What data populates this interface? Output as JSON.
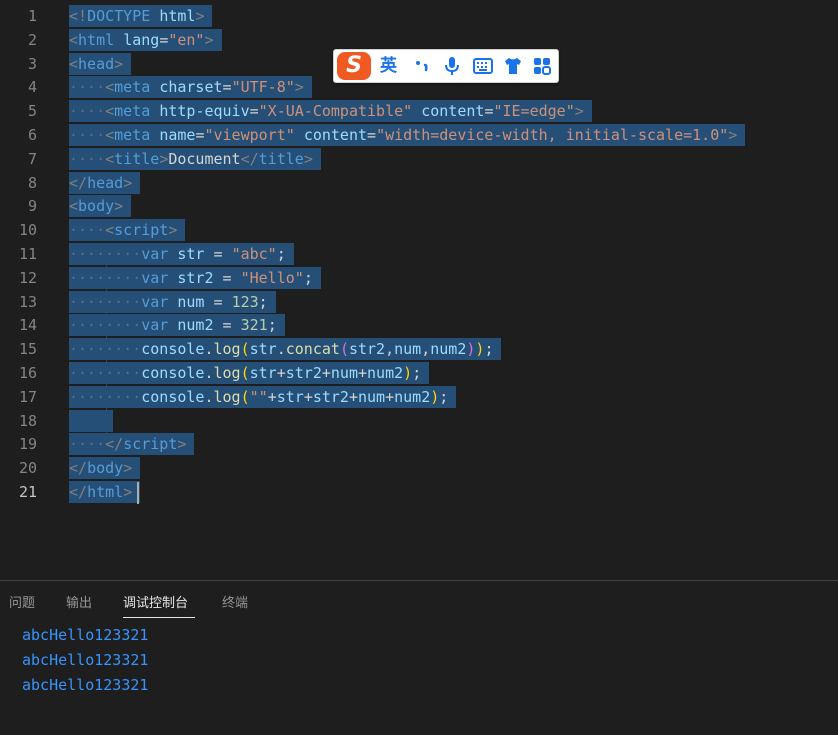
{
  "editor": {
    "lines": [
      {
        "num": "1",
        "segs": [
          [
            "tg",
            "<!"
          ],
          [
            "tn",
            "DOCTYPE"
          ],
          [
            "pl",
            " "
          ],
          [
            "an",
            "html"
          ],
          [
            "tg",
            ">"
          ]
        ]
      },
      {
        "num": "2",
        "segs": [
          [
            "tg",
            "<"
          ],
          [
            "tn",
            "html"
          ],
          [
            "pl",
            " "
          ],
          [
            "an",
            "lang"
          ],
          [
            "pl",
            "="
          ],
          [
            "av",
            "\"en\""
          ],
          [
            "tg",
            ">"
          ]
        ]
      },
      {
        "num": "3",
        "segs": [
          [
            "tg",
            "<"
          ],
          [
            "tn",
            "head"
          ],
          [
            "tg",
            ">"
          ]
        ]
      },
      {
        "num": "4",
        "segs": [
          [
            "ws",
            "····"
          ],
          [
            "tg",
            "<"
          ],
          [
            "tn",
            "meta"
          ],
          [
            "pl",
            " "
          ],
          [
            "an",
            "charset"
          ],
          [
            "pl",
            "="
          ],
          [
            "av",
            "\"UTF-8\""
          ],
          [
            "tg",
            ">"
          ]
        ]
      },
      {
        "num": "5",
        "segs": [
          [
            "ws",
            "····"
          ],
          [
            "tg",
            "<"
          ],
          [
            "tn",
            "meta"
          ],
          [
            "pl",
            " "
          ],
          [
            "an",
            "http-equiv"
          ],
          [
            "pl",
            "="
          ],
          [
            "av",
            "\"X-UA-Compatible\""
          ],
          [
            "pl",
            " "
          ],
          [
            "an",
            "content"
          ],
          [
            "pl",
            "="
          ],
          [
            "av",
            "\"IE=edge\""
          ],
          [
            "tg",
            ">"
          ]
        ]
      },
      {
        "num": "6",
        "segs": [
          [
            "ws",
            "····"
          ],
          [
            "tg",
            "<"
          ],
          [
            "tn",
            "meta"
          ],
          [
            "pl",
            " "
          ],
          [
            "an",
            "name"
          ],
          [
            "pl",
            "="
          ],
          [
            "av",
            "\"viewport\""
          ],
          [
            "pl",
            " "
          ],
          [
            "an",
            "content"
          ],
          [
            "pl",
            "="
          ],
          [
            "av",
            "\"width=device-width, initial-scale=1.0\""
          ],
          [
            "tg",
            ">"
          ]
        ]
      },
      {
        "num": "7",
        "segs": [
          [
            "ws",
            "····"
          ],
          [
            "tg",
            "<"
          ],
          [
            "tn",
            "title"
          ],
          [
            "tg",
            ">"
          ],
          [
            "pl",
            "Document"
          ],
          [
            "tg",
            "</"
          ],
          [
            "tn",
            "title"
          ],
          [
            "tg",
            ">"
          ]
        ]
      },
      {
        "num": "8",
        "segs": [
          [
            "tg",
            "</"
          ],
          [
            "tn",
            "head"
          ],
          [
            "tg",
            ">"
          ]
        ]
      },
      {
        "num": "9",
        "segs": [
          [
            "tg",
            "<"
          ],
          [
            "tn",
            "body"
          ],
          [
            "tg",
            ">"
          ]
        ]
      },
      {
        "num": "10",
        "segs": [
          [
            "ws",
            "····"
          ],
          [
            "tg",
            "<"
          ],
          [
            "tn",
            "script"
          ],
          [
            "tg",
            ">"
          ]
        ]
      },
      {
        "num": "11",
        "segs": [
          [
            "ws",
            "········"
          ],
          [
            "kw",
            "var"
          ],
          [
            "pl",
            " "
          ],
          [
            "vn",
            "str"
          ],
          [
            "pl",
            " = "
          ],
          [
            "st",
            "\"abc\""
          ],
          [
            "pl",
            ";"
          ]
        ]
      },
      {
        "num": "12",
        "segs": [
          [
            "ws",
            "········"
          ],
          [
            "kw",
            "var"
          ],
          [
            "pl",
            " "
          ],
          [
            "vn",
            "str2"
          ],
          [
            "pl",
            " = "
          ],
          [
            "st",
            "\"Hello\""
          ],
          [
            "pl",
            ";"
          ]
        ]
      },
      {
        "num": "13",
        "segs": [
          [
            "ws",
            "········"
          ],
          [
            "kw",
            "var"
          ],
          [
            "pl",
            " "
          ],
          [
            "vn",
            "num"
          ],
          [
            "pl",
            " = "
          ],
          [
            "nm",
            "123"
          ],
          [
            "pl",
            ";"
          ]
        ]
      },
      {
        "num": "14",
        "segs": [
          [
            "ws",
            "········"
          ],
          [
            "kw",
            "var"
          ],
          [
            "pl",
            " "
          ],
          [
            "vn",
            "num2"
          ],
          [
            "pl",
            " = "
          ],
          [
            "nm",
            "321"
          ],
          [
            "pl",
            ";"
          ]
        ]
      },
      {
        "num": "15",
        "segs": [
          [
            "ws",
            "········"
          ],
          [
            "vn",
            "console"
          ],
          [
            "pl",
            "."
          ],
          [
            "fn",
            "log"
          ],
          [
            "br2",
            "("
          ],
          [
            "vn",
            "str"
          ],
          [
            "pl",
            "."
          ],
          [
            "fn",
            "concat"
          ],
          [
            "br1",
            "("
          ],
          [
            "vn",
            "str2"
          ],
          [
            "pl",
            ","
          ],
          [
            "vn",
            "num"
          ],
          [
            "pl",
            ","
          ],
          [
            "vn",
            "num2"
          ],
          [
            "br1",
            ")"
          ],
          [
            "br2",
            ")"
          ],
          [
            "pl",
            ";"
          ]
        ]
      },
      {
        "num": "16",
        "segs": [
          [
            "ws",
            "········"
          ],
          [
            "vn",
            "console"
          ],
          [
            "pl",
            "."
          ],
          [
            "fn",
            "log"
          ],
          [
            "br2",
            "("
          ],
          [
            "vn",
            "str"
          ],
          [
            "pl",
            "+"
          ],
          [
            "vn",
            "str2"
          ],
          [
            "pl",
            "+"
          ],
          [
            "vn",
            "num"
          ],
          [
            "pl",
            "+"
          ],
          [
            "vn",
            "num2"
          ],
          [
            "br2",
            ")"
          ],
          [
            "pl",
            ";"
          ]
        ]
      },
      {
        "num": "17",
        "segs": [
          [
            "ws",
            "········"
          ],
          [
            "vn",
            "console"
          ],
          [
            "pl",
            "."
          ],
          [
            "fn",
            "log"
          ],
          [
            "br2",
            "("
          ],
          [
            "st",
            "\"\""
          ],
          [
            "pl",
            "+"
          ],
          [
            "vn",
            "str"
          ],
          [
            "pl",
            "+"
          ],
          [
            "vn",
            "str2"
          ],
          [
            "pl",
            "+"
          ],
          [
            "vn",
            "num"
          ],
          [
            "pl",
            "+"
          ],
          [
            "vn",
            "num2"
          ],
          [
            "br2",
            ")"
          ],
          [
            "pl",
            ";"
          ]
        ]
      },
      {
        "num": "18",
        "segs": [
          [
            "ws",
            "    "
          ]
        ]
      },
      {
        "num": "19",
        "segs": [
          [
            "ws",
            "····"
          ],
          [
            "tg",
            "</"
          ],
          [
            "tn",
            "script"
          ],
          [
            "tg",
            ">"
          ]
        ]
      },
      {
        "num": "20",
        "segs": [
          [
            "tg",
            "</"
          ],
          [
            "tn",
            "body"
          ],
          [
            "tg",
            ">"
          ]
        ]
      },
      {
        "num": "21",
        "segs": [
          [
            "tg",
            "</"
          ],
          [
            "tn",
            "html"
          ],
          [
            "tg",
            ">"
          ]
        ]
      }
    ],
    "active_line": "21"
  },
  "ime": {
    "logo": "S",
    "lang": "英",
    "icons": [
      "punctuation-icon",
      "microphone-icon",
      "keyboard-icon",
      "skin-icon",
      "toolbox-icon"
    ]
  },
  "panel": {
    "tabs": [
      "问题",
      "输出",
      "调试控制台",
      "终端"
    ],
    "active_tab": "调试控制台",
    "output": [
      "abcHello123321",
      "abcHello123321",
      "abcHello123321"
    ]
  }
}
